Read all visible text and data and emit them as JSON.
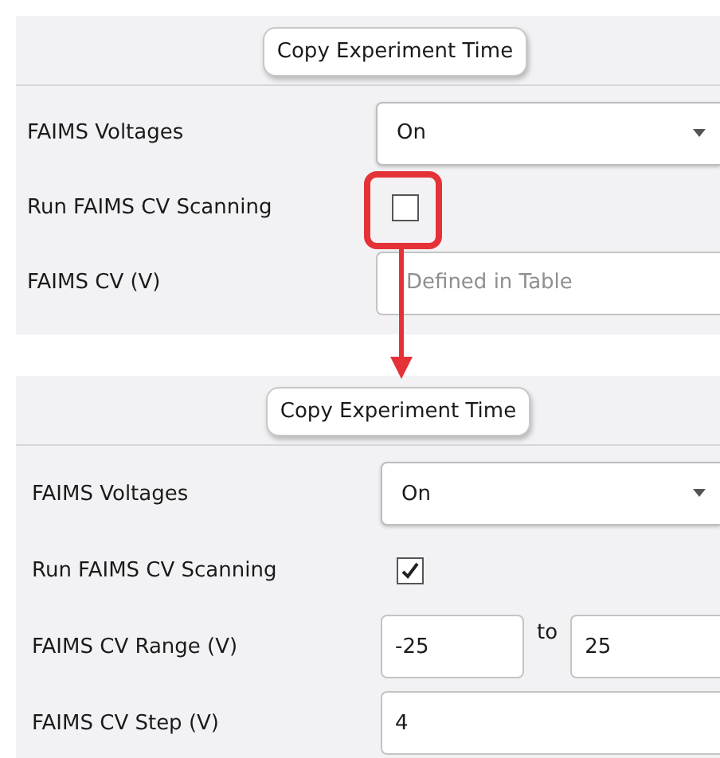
{
  "panels": [
    {
      "button": "Copy Experiment Time",
      "fields": [
        {
          "kind": "dropdown",
          "label": "FAIMS Voltages",
          "value": "On"
        },
        {
          "kind": "checkbox",
          "label": "Run FAIMS CV Scanning",
          "checked": false
        },
        {
          "kind": "text",
          "label": "FAIMS CV (V)",
          "placeholder": "Defined in Table"
        }
      ]
    },
    {
      "button": "Copy Experiment Time",
      "fields": [
        {
          "kind": "dropdown",
          "label": "FAIMS Voltages",
          "value": "On"
        },
        {
          "kind": "checkbox",
          "label": "Run FAIMS CV Scanning",
          "checked": true
        },
        {
          "kind": "range",
          "label": "FAIMS CV Range (V)",
          "from": "-25",
          "separator": "to",
          "to": "25"
        },
        {
          "kind": "text",
          "label": "FAIMS CV Step (V)",
          "value": "4"
        }
      ]
    }
  ]
}
